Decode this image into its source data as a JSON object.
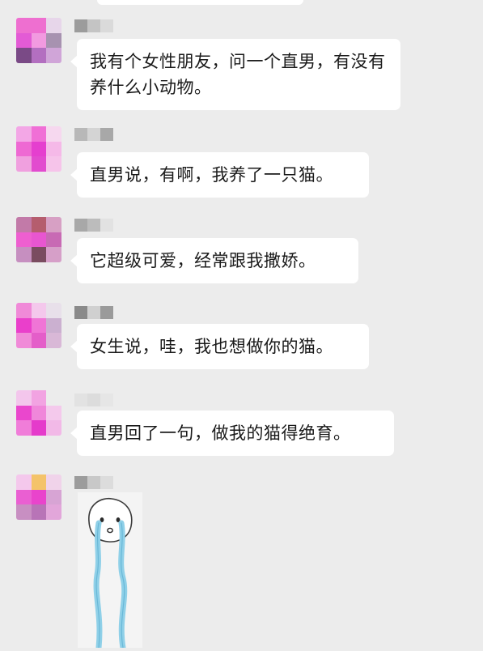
{
  "messages": [
    {
      "text": "我有个女性朋友，问一个直男，有没有养什么小动物。"
    },
    {
      "text": "直男说，有啊，我养了一只猫。"
    },
    {
      "text": "它超级可爱，经常跟我撒娇。"
    },
    {
      "text": "女生说，哇，我也想做你的猫。"
    },
    {
      "text": "直男回了一句，做我的猫得绝育。"
    }
  ],
  "sticker": {
    "icon": "crying-face-sticker-icon"
  },
  "colors": {
    "background": "#ececec",
    "bubble": "#ffffff",
    "text": "#1a1a1a",
    "sticker_tears": "#8fd0e8"
  }
}
